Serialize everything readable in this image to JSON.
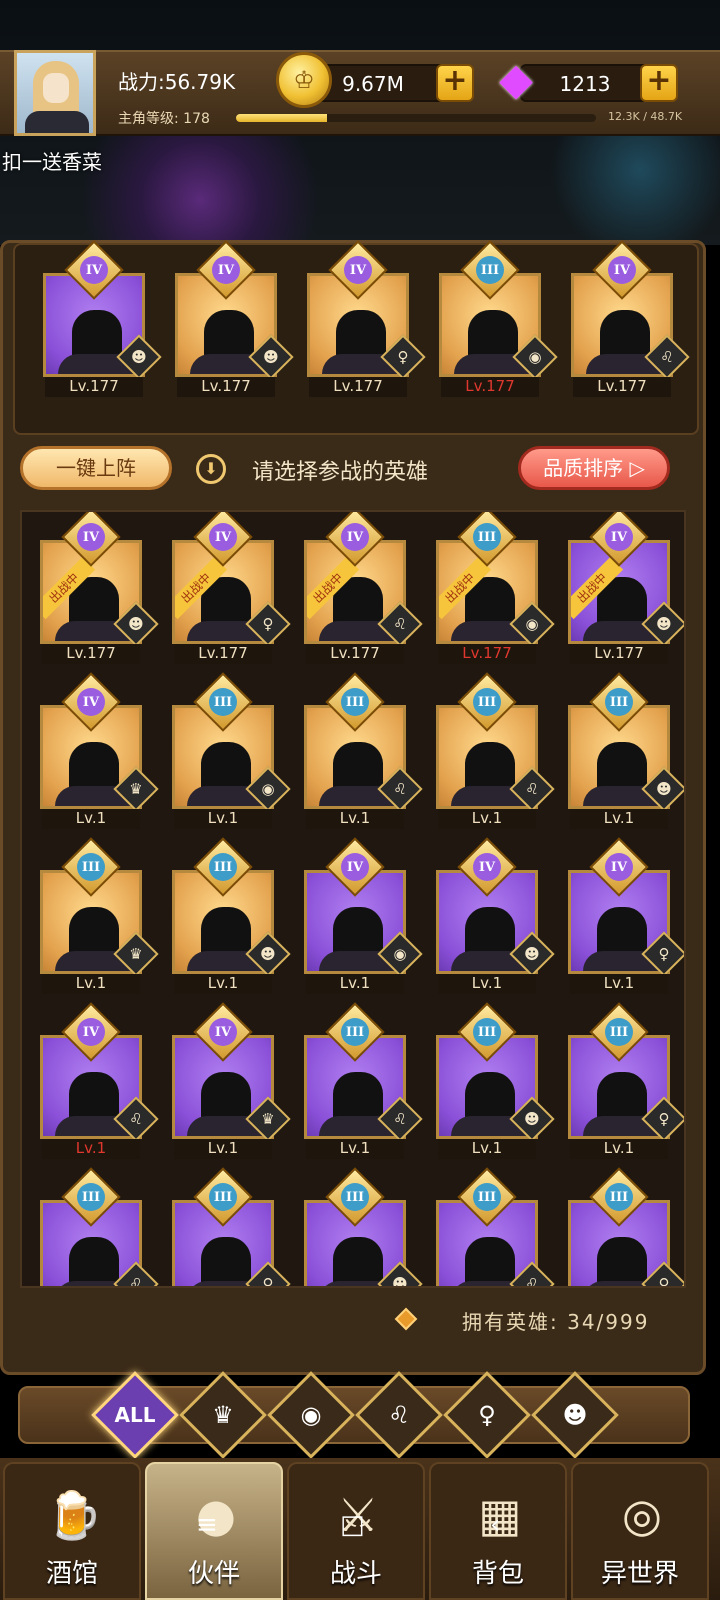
{
  "header": {
    "power_label": "战力:56.79K",
    "level_label": "主角等级:",
    "level": "178",
    "xp_text": "12.3K / 48.7K",
    "xp_fraction": 0.253,
    "gold": "9.67M",
    "gems": "1213",
    "plus": "+"
  },
  "promo": "扣一送香菜",
  "team": [
    {
      "tier": "IV",
      "bg": "purple",
      "faction": "demon",
      "lv": "Lv.177",
      "red": false
    },
    {
      "tier": "IV",
      "bg": "gold",
      "faction": "demon",
      "lv": "Lv.177",
      "red": false
    },
    {
      "tier": "IV",
      "bg": "gold",
      "faction": "elf",
      "lv": "Lv.177",
      "red": false
    },
    {
      "tier": "III",
      "bg": "gold",
      "faction": "fish",
      "lv": "Lv.177",
      "red": true
    },
    {
      "tier": "IV",
      "bg": "gold",
      "faction": "lion",
      "lv": "Lv.177",
      "red": false
    }
  ],
  "controls": {
    "one_key": "一键上阵",
    "hint": "请选择参战的英雄",
    "sort": "品质排序",
    "sort_arrow": "▷",
    "down_arrow": "⬇"
  },
  "deployed_ribbon": "出战中",
  "heroes": [
    {
      "tier": "IV",
      "bg": "gold",
      "faction": "demon",
      "lv": "Lv.177",
      "red": false,
      "deployed": true
    },
    {
      "tier": "IV",
      "bg": "gold",
      "faction": "elf",
      "lv": "Lv.177",
      "red": false,
      "deployed": true
    },
    {
      "tier": "IV",
      "bg": "gold",
      "faction": "lion",
      "lv": "Lv.177",
      "red": false,
      "deployed": true
    },
    {
      "tier": "III",
      "bg": "gold",
      "faction": "fish",
      "lv": "Lv.177",
      "red": true,
      "deployed": true
    },
    {
      "tier": "IV",
      "bg": "purple",
      "faction": "demon",
      "lv": "Lv.177",
      "red": false,
      "deployed": true
    },
    {
      "tier": "IV",
      "bg": "gold",
      "faction": "knight",
      "lv": "Lv.1",
      "red": false,
      "deployed": false
    },
    {
      "tier": "III",
      "bg": "gold",
      "faction": "fish",
      "lv": "Lv.1",
      "red": false,
      "deployed": false
    },
    {
      "tier": "III",
      "bg": "gold",
      "faction": "lion",
      "lv": "Lv.1",
      "red": false,
      "deployed": false
    },
    {
      "tier": "III",
      "bg": "gold",
      "faction": "lion",
      "lv": "Lv.1",
      "red": false,
      "deployed": false
    },
    {
      "tier": "III",
      "bg": "gold",
      "faction": "demon",
      "lv": "Lv.1",
      "red": false,
      "deployed": false
    },
    {
      "tier": "III",
      "bg": "gold",
      "faction": "knight",
      "lv": "Lv.1",
      "red": false,
      "deployed": false
    },
    {
      "tier": "III",
      "bg": "gold",
      "faction": "demon",
      "lv": "Lv.1",
      "red": false,
      "deployed": false
    },
    {
      "tier": "IV",
      "bg": "purple",
      "faction": "fish",
      "lv": "Lv.1",
      "red": false,
      "deployed": false
    },
    {
      "tier": "IV",
      "bg": "purple",
      "faction": "demon",
      "lv": "Lv.1",
      "red": false,
      "deployed": false
    },
    {
      "tier": "IV",
      "bg": "purple",
      "faction": "elf",
      "lv": "Lv.1",
      "red": false,
      "deployed": false
    },
    {
      "tier": "IV",
      "bg": "purple",
      "faction": "lion",
      "lv": "Lv.1",
      "red": true,
      "deployed": false
    },
    {
      "tier": "IV",
      "bg": "purple",
      "faction": "knight",
      "lv": "Lv.1",
      "red": false,
      "deployed": false
    },
    {
      "tier": "III",
      "bg": "purple",
      "faction": "lion",
      "lv": "Lv.1",
      "red": false,
      "deployed": false
    },
    {
      "tier": "III",
      "bg": "purple",
      "faction": "demon",
      "lv": "Lv.1",
      "red": false,
      "deployed": false
    },
    {
      "tier": "III",
      "bg": "purple",
      "faction": "elf",
      "lv": "Lv.1",
      "red": false,
      "deployed": false
    },
    {
      "tier": "III",
      "bg": "purple",
      "faction": "lion",
      "lv": "",
      "red": false,
      "deployed": false
    },
    {
      "tier": "III",
      "bg": "purple",
      "faction": "elf",
      "lv": "",
      "red": false,
      "deployed": false
    },
    {
      "tier": "III",
      "bg": "purple",
      "faction": "demon",
      "lv": "",
      "red": false,
      "deployed": false
    },
    {
      "tier": "III",
      "bg": "purple",
      "faction": "lion",
      "lv": "",
      "red": false,
      "deployed": false
    },
    {
      "tier": "III",
      "bg": "purple",
      "faction": "elf",
      "lv": "",
      "red": false,
      "deployed": false
    }
  ],
  "faction_glyphs": {
    "demon": "☻",
    "elf": "♀",
    "fish": "◉",
    "lion": "♌",
    "knight": "♛"
  },
  "owned": "拥有英雄: 34/999",
  "filters": [
    {
      "label": "ALL",
      "icon": "all-icon",
      "active": true
    },
    {
      "label": "♛",
      "icon": "knight-faction-icon",
      "active": false
    },
    {
      "label": "◉",
      "icon": "fish-faction-icon",
      "active": false
    },
    {
      "label": "♌",
      "icon": "lion-faction-icon",
      "active": false
    },
    {
      "label": "♀",
      "icon": "elf-faction-icon",
      "active": false
    },
    {
      "label": "☻",
      "icon": "demon-faction-icon",
      "active": false
    }
  ],
  "nav": [
    {
      "label": "酒馆",
      "icon": "tavern-icon",
      "glyph": "🍺",
      "active": false
    },
    {
      "label": "伙伴",
      "icon": "partner-icon",
      "glyph": "●",
      "active": true
    },
    {
      "label": "战斗",
      "icon": "battle-icon",
      "glyph": "⚔",
      "active": false
    },
    {
      "label": "背包",
      "icon": "bag-icon",
      "glyph": "▦",
      "active": false
    },
    {
      "label": "异世界",
      "icon": "portal-icon",
      "glyph": "◎",
      "active": false
    }
  ],
  "system_nav": [
    "≡",
    "□",
    "‹"
  ]
}
